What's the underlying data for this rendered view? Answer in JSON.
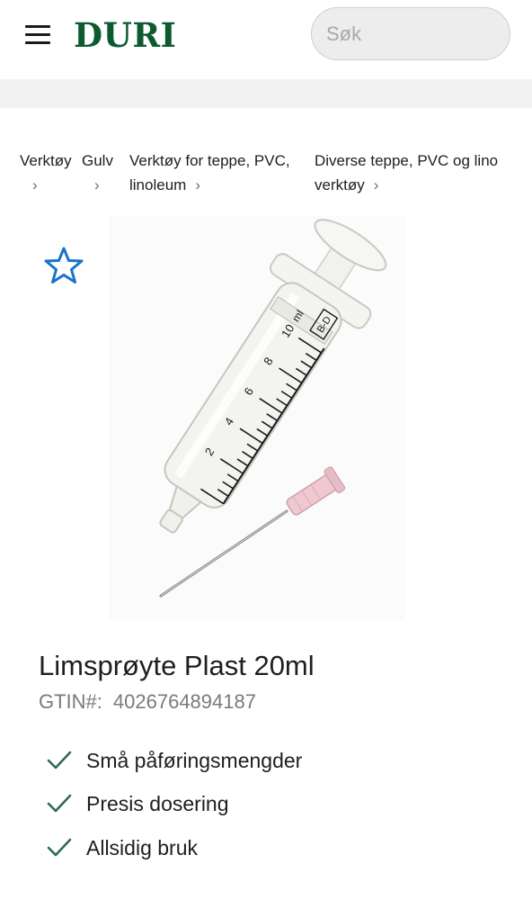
{
  "header": {
    "logo": "DURI",
    "search_placeholder": "Søk"
  },
  "breadcrumb": [
    {
      "label": "Verktøy",
      "chevron": "›"
    },
    {
      "label": "Gulv",
      "chevron": "›"
    },
    {
      "label_line1": "Verktøy for teppe, PVC,",
      "label_line2": "linoleum",
      "chevron": "›"
    },
    {
      "label_line1": "Diverse teppe, PVC og lino",
      "label_line2": "verktøy",
      "chevron": "›"
    }
  ],
  "product": {
    "title": "Limsprøyte Plast 20ml",
    "gtin_label": "GTIN#:",
    "gtin_value": "4026764894187",
    "image_scale": {
      "brand": "B-D",
      "unit": "ml",
      "ticks": [
        "10",
        "8",
        "6",
        "4",
        "2"
      ]
    },
    "features": [
      "Små påføringsmengder",
      "Presis dosering",
      "Allsidig bruk"
    ]
  },
  "colors": {
    "brand": "#0d5a31",
    "favorite": "#1a73c9",
    "check": "#2e6b4f"
  },
  "icons": {
    "menu": "hamburger-menu-icon",
    "favorite": "star-outline-icon",
    "check": "checkmark-icon",
    "chevron": "chevron-right-icon"
  }
}
